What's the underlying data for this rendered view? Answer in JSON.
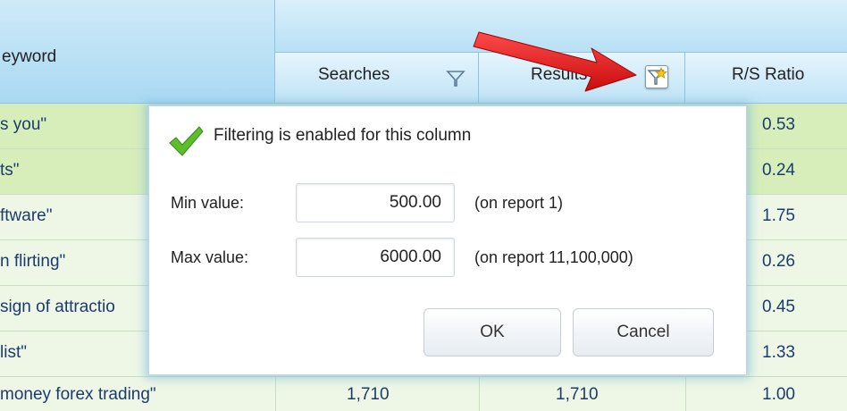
{
  "header": {
    "keyword_label": "eyword",
    "columns": {
      "searches": "Searches",
      "results": "Results",
      "rs_ratio": "R/S Ratio"
    }
  },
  "rows": [
    {
      "keyword": "s you\"",
      "ratio": "0.53"
    },
    {
      "keyword": "ts\"",
      "ratio": "0.24"
    },
    {
      "keyword": "ftware\"",
      "ratio": "1.75"
    },
    {
      "keyword": "n flirting\"",
      "ratio": "0.26"
    },
    {
      "keyword": "sign of attractio",
      "ratio": "0.45"
    },
    {
      "keyword": "list\"",
      "ratio": "1.33"
    },
    {
      "keyword": "money forex trading\"",
      "searches": "1,710",
      "results": "1,710",
      "ratio": "1.00"
    }
  ],
  "filter_dialog": {
    "enabled_text": "Filtering is enabled for this column",
    "min_label": "Min value:",
    "min_value": "500.00",
    "min_note": "(on report 1)",
    "max_label": "Max value:",
    "max_value": "6000.00",
    "max_note": "(on report 11,100,000)",
    "ok_label": "OK",
    "cancel_label": "Cancel"
  },
  "colors": {
    "header_blue": "#bfe3f6",
    "row_highlight": "#d7eebb",
    "row_normal": "#eef7e6",
    "arrow_red": "#e01818",
    "cell_text": "#1c3b6e"
  },
  "icons": [
    "filter-icon",
    "filter-star-icon",
    "checkmark-icon",
    "red-arrow-icon"
  ]
}
